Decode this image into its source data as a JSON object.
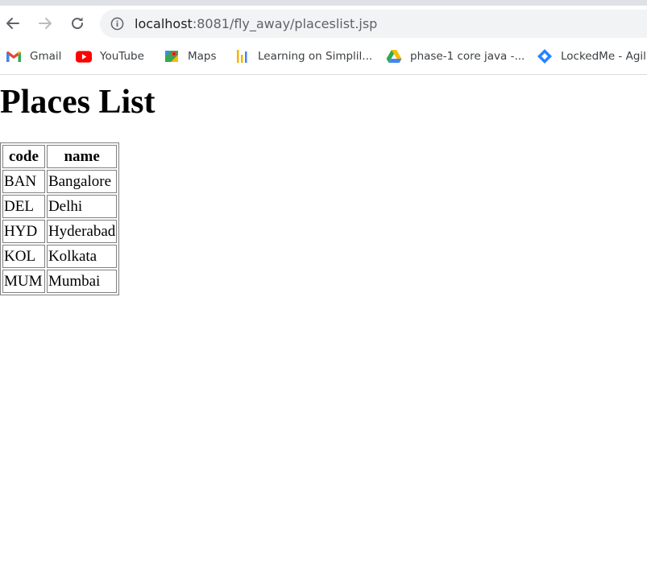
{
  "browser": {
    "url_host": "localhost",
    "url_path": ":8081/fly_away/placeslist.jsp",
    "bookmarks": [
      {
        "label": "Gmail",
        "icon": "gmail-icon"
      },
      {
        "label": "YouTube",
        "icon": "youtube-icon"
      },
      {
        "label": "Maps",
        "icon": "maps-icon"
      },
      {
        "label": "Learning on Simplil...",
        "icon": "simplilearn-icon"
      },
      {
        "label": "phase-1 core java -...",
        "icon": "google-drive-icon"
      },
      {
        "label": "LockedMe - Agil",
        "icon": "jira-icon"
      }
    ]
  },
  "page": {
    "title": "Places List",
    "table": {
      "headers": [
        "code",
        "name"
      ],
      "rows": [
        {
          "code": "BAN",
          "name": "Bangalore"
        },
        {
          "code": "DEL",
          "name": "Delhi"
        },
        {
          "code": "HYD",
          "name": "Hyderabad"
        },
        {
          "code": "KOL",
          "name": "Kolkata"
        },
        {
          "code": "MUM",
          "name": "Mumbai"
        }
      ]
    }
  },
  "colors": {
    "chrome_background": "#ffffff",
    "omnibox_background": "#f1f3f4",
    "table_border": "#808080",
    "text": "#000000"
  }
}
